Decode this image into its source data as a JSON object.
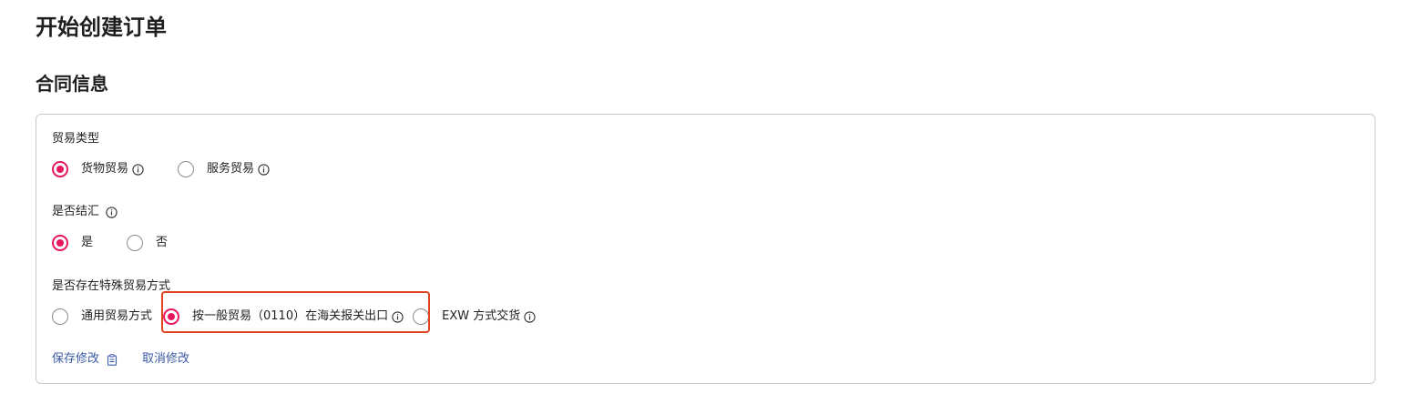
{
  "page": {
    "title": "开始创建订单"
  },
  "contract": {
    "section_title": "合同信息",
    "trade_type": {
      "label": "贸易类型",
      "options": [
        {
          "label": "货物贸易",
          "selected": true,
          "info_icon": "info-icon"
        },
        {
          "label": "服务贸易",
          "selected": false,
          "info_icon": "info-icon"
        }
      ]
    },
    "settlement": {
      "label": "是否结汇",
      "info_icon": "info-icon",
      "options": [
        {
          "label": "是",
          "selected": true
        },
        {
          "label": "否",
          "selected": false
        }
      ]
    },
    "special_trade": {
      "label": "是否存在特殊贸易方式",
      "options": [
        {
          "label": "通用贸易方式",
          "selected": false
        },
        {
          "label": "按一般贸易（0110）在海关报关出口",
          "selected": true,
          "info_icon": "info-icon"
        },
        {
          "label": "EXW 方式交货",
          "selected": false,
          "info_icon": "info-icon"
        }
      ]
    },
    "actions": {
      "save_label": "保存修改",
      "save_icon": "clipboard-icon",
      "cancel_label": "取消修改"
    }
  },
  "colors": {
    "accent": "#e8175d",
    "highlight_border": "#e04420",
    "link": "#3d5aa8",
    "card_border": "#c9c9c9"
  }
}
